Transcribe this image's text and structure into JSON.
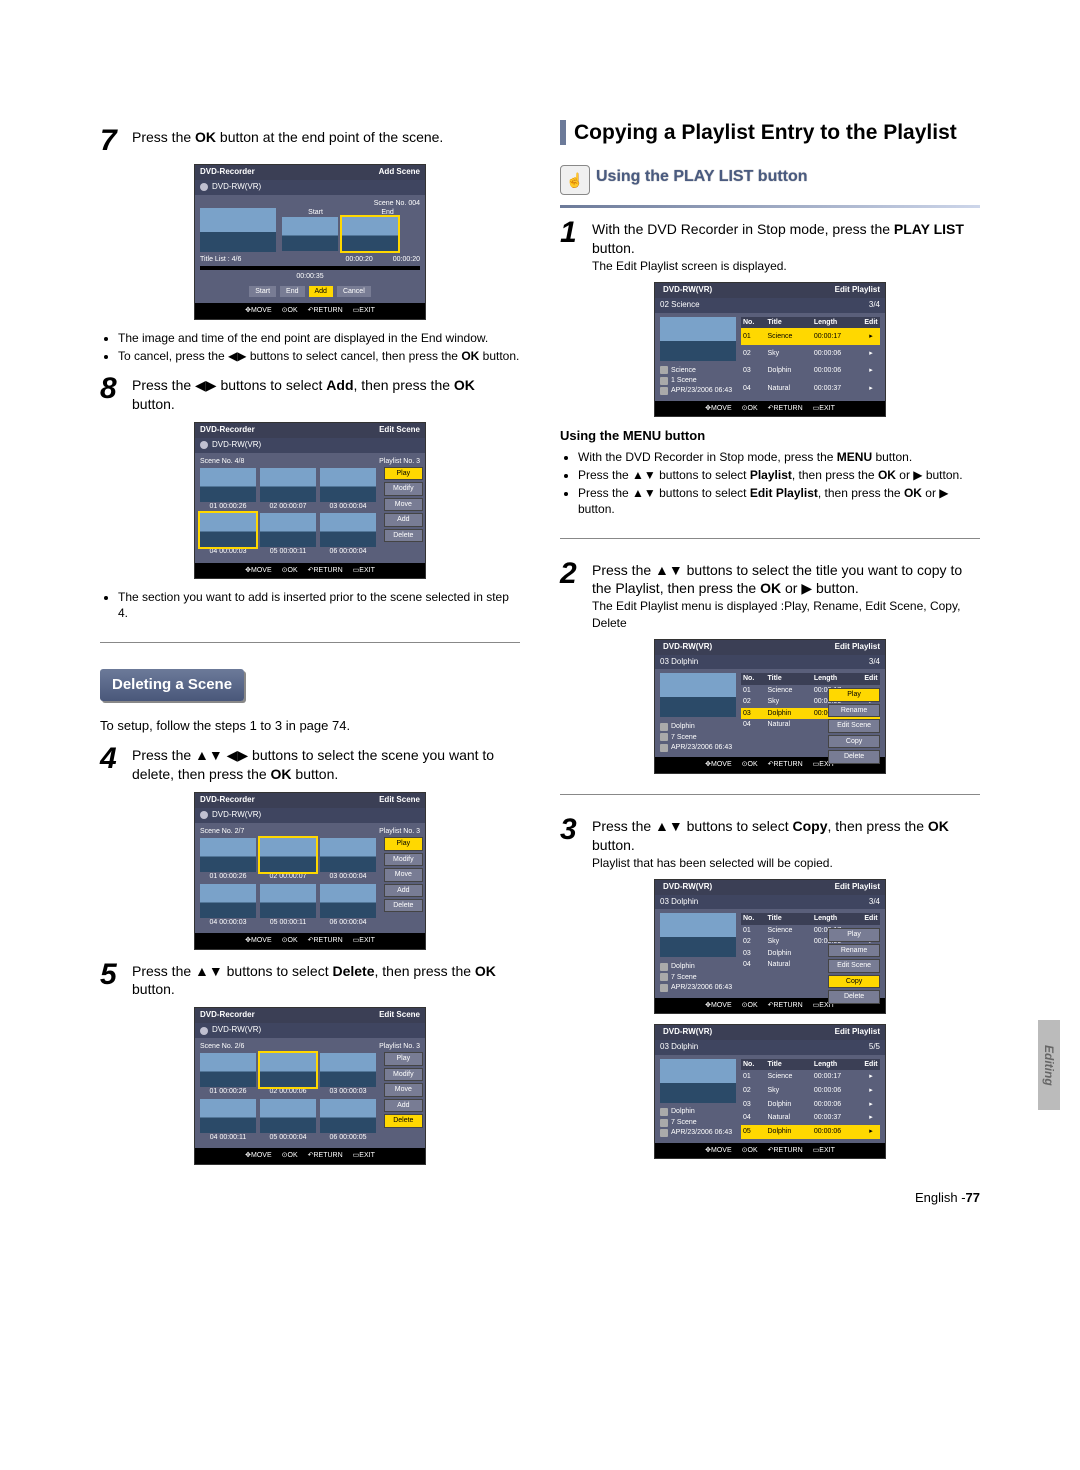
{
  "left": {
    "step7": {
      "num": "7",
      "text_a": "Press the ",
      "bold_a": "OK",
      "text_b": " button at the end point of the scene.",
      "bullets": [
        "The image and time of the end point are displayed in the End window.",
        "To cancel, press the ◀▶ buttons to select cancel, then press the OK button."
      ]
    },
    "screen7": {
      "title": "DVD-Recorder",
      "mode": "Add Scene",
      "disc": "DVD-RW(VR)",
      "scene_no": "Scene No. 004",
      "start_lbl": "Start",
      "end_lbl": "End",
      "title_list": "Title List : 4/6",
      "t1": "00:00:20",
      "t2": "00:00:20",
      "t3": "00:00:35",
      "btns": [
        "Start",
        "End",
        "Add",
        "Cancel"
      ],
      "bar": {
        "move": "MOVE",
        "ok": "OK",
        "return": "RETURN",
        "exit": "EXIT"
      }
    },
    "step8": {
      "num": "8",
      "text": "Press the ◀▶ buttons to select Add, then press the OK button.",
      "bullets": [
        "The section you want to add is inserted prior to the scene selected in step 4."
      ]
    },
    "screen8": {
      "title": "DVD-Recorder",
      "mode": "Edit Scene",
      "disc": "DVD-RW(VR)",
      "scene_no": "Scene No.    4/8",
      "playlist": "Playlist No. 3",
      "cells": [
        {
          "n": "01",
          "t": "00:00:26"
        },
        {
          "n": "02",
          "t": "00:00:07"
        },
        {
          "n": "03",
          "t": "00:00:04"
        },
        {
          "n": "04",
          "t": "00:00:03"
        },
        {
          "n": "05",
          "t": "00:00:11"
        },
        {
          "n": "06",
          "t": "00:00:04"
        }
      ],
      "menu": [
        "Play",
        "Modify",
        "Move",
        "Add",
        "Delete"
      ],
      "bar": {
        "move": "MOVE",
        "ok": "OK",
        "return": "RETURN",
        "exit": "EXIT"
      }
    },
    "delete_heading": "Deleting a Scene",
    "delete_intro": "To setup, follow the steps 1 to 3 in page 74.",
    "step4": {
      "num": "4",
      "text": "Press the ▲▼ ◀▶ buttons to select the scene you want to delete, then press the OK button."
    },
    "screen4": {
      "title": "DVD-Recorder",
      "mode": "Edit Scene",
      "disc": "DVD-RW(VR)",
      "scene_no": "Scene No.    2/7",
      "playlist": "Playlist No. 3",
      "cells": [
        {
          "n": "01",
          "t": "00:00:26"
        },
        {
          "n": "02",
          "t": "00:00:07"
        },
        {
          "n": "03",
          "t": "00:00:04"
        },
        {
          "n": "04",
          "t": "00:00:03"
        },
        {
          "n": "05",
          "t": "00:00:11"
        },
        {
          "n": "06",
          "t": "00:00:04"
        }
      ],
      "menu": [
        "Play",
        "Modify",
        "Move",
        "Add",
        "Delete"
      ],
      "bar": {
        "move": "MOVE",
        "ok": "OK",
        "return": "RETURN",
        "exit": "EXIT"
      }
    },
    "step5": {
      "num": "5",
      "text": "Press the ▲▼ buttons to select Delete, then press the OK button."
    },
    "screen5": {
      "title": "DVD-Recorder",
      "mode": "Edit Scene",
      "disc": "DVD-RW(VR)",
      "scene_no": "Scene No.    2/6",
      "playlist": "Playlist No. 3",
      "cells": [
        {
          "n": "01",
          "t": "00:00:26"
        },
        {
          "n": "02",
          "t": "00:00:06"
        },
        {
          "n": "03",
          "t": "00:00:03"
        },
        {
          "n": "04",
          "t": "00:00:11"
        },
        {
          "n": "05",
          "t": "00:00:04"
        },
        {
          "n": "06",
          "t": "00:00:05"
        }
      ],
      "menu": [
        "Play",
        "Modify",
        "Move",
        "Add",
        "Delete"
      ],
      "bar": {
        "move": "MOVE",
        "ok": "OK",
        "return": "RETURN",
        "exit": "EXIT"
      }
    }
  },
  "right": {
    "h1": "Copying a Playlist Entry to the Playlist",
    "h2": "Using the PLAY LIST button",
    "step1": {
      "num": "1",
      "l1": "With the DVD Recorder in Stop mode, press the PLAY LIST button.",
      "l2": "The Edit Playlist screen is displayed."
    },
    "screen1": {
      "disc": "DVD-RW(VR)",
      "mode": "Edit Playlist",
      "sub": "02 Science",
      "counter": "3/4",
      "headers": {
        "no": "No.",
        "title": "Title",
        "length": "Length",
        "edit": "Edit"
      },
      "rows": [
        {
          "no": "01",
          "title": "Science",
          "length": "00:00:17",
          "hl": true
        },
        {
          "no": "02",
          "title": "Sky",
          "length": "00:00:06"
        },
        {
          "no": "03",
          "title": "Dolphin",
          "length": "00:00:06"
        },
        {
          "no": "04",
          "title": "Natural",
          "length": "00:00:37"
        }
      ],
      "meta": {
        "t": "Science",
        "s": "1 Scene",
        "d": "APR/23/2006 06:43"
      },
      "bar": {
        "move": "MOVE",
        "ok": "OK",
        "return": "RETURN",
        "exit": "EXIT"
      }
    },
    "menu_h": "Using the MENU button",
    "menu_bullets": [
      "With the DVD Recorder in Stop mode, press the MENU button.",
      "Press the ▲▼ buttons to select Playlist, then press the OK or ▶ button.",
      "Press the ▲▼ buttons to select Edit Playlist, then press the OK or ▶ button."
    ],
    "step2": {
      "num": "2",
      "l1": "Press the ▲▼ buttons to select the title you want to copy to the Playlist, then press the OK or ▶ button.",
      "l2": "The Edit Playlist menu is displayed :Play, Rename, Edit Scene, Copy, Delete"
    },
    "screen2": {
      "disc": "DVD-RW(VR)",
      "mode": "Edit Playlist",
      "sub": "03 Dolphin",
      "counter": "3/4",
      "rows": [
        {
          "no": "01",
          "title": "Science",
          "length": "00:00:17"
        },
        {
          "no": "02",
          "title": "Sky",
          "length": "00:00:06"
        },
        {
          "no": "03",
          "title": "Dolphin",
          "length": "00:00:06",
          "hl": true
        },
        {
          "no": "04",
          "title": "Natural",
          "length": ""
        }
      ],
      "menu": [
        "Play",
        "Rename",
        "Edit Scene",
        "Copy",
        "Delete"
      ],
      "meta": {
        "t": "Dolphin",
        "s": "7 Scene",
        "d": "APR/23/2006 06:43"
      },
      "bar": {
        "move": "MOVE",
        "ok": "OK",
        "return": "RETURN",
        "exit": "EXIT"
      }
    },
    "step3": {
      "num": "3",
      "l1": "Press the ▲▼ buttons to select Copy, then press the OK button.",
      "l2": "Playlist that has been selected will be copied."
    },
    "screen3a": {
      "disc": "DVD-RW(VR)",
      "mode": "Edit Playlist",
      "sub": "03 Dolphin",
      "counter": "3/4",
      "rows": [
        {
          "no": "01",
          "title": "Science",
          "length": "00:00:17"
        },
        {
          "no": "02",
          "title": "Sky",
          "length": "00:00:06"
        },
        {
          "no": "03",
          "title": "Dolphin",
          "length": ""
        },
        {
          "no": "04",
          "title": "Natural",
          "length": ""
        }
      ],
      "menu": [
        "Play",
        "Rename",
        "Edit Scene",
        "Copy",
        "Delete"
      ],
      "menu_hl": "Copy",
      "meta": {
        "t": "Dolphin",
        "s": "7 Scene",
        "d": "APR/23/2006 06:43"
      },
      "bar": {
        "move": "MOVE",
        "ok": "OK",
        "return": "RETURN",
        "exit": "EXIT"
      }
    },
    "screen3b": {
      "disc": "DVD-RW(VR)",
      "mode": "Edit Playlist",
      "sub": "03 Dolphin",
      "counter": "5/5",
      "rows": [
        {
          "no": "01",
          "title": "Science",
          "length": "00:00:17"
        },
        {
          "no": "02",
          "title": "Sky",
          "length": "00:00:06"
        },
        {
          "no": "03",
          "title": "Dolphin",
          "length": "00:00:06"
        },
        {
          "no": "04",
          "title": "Natural",
          "length": "00:00:37"
        },
        {
          "no": "05",
          "title": "Dolphin",
          "length": "00:00:06",
          "hl": true
        }
      ],
      "meta": {
        "t": "Dolphin",
        "s": "7 Scene",
        "d": "APR/23/2006 06:43"
      },
      "bar": {
        "move": "MOVE",
        "ok": "OK",
        "return": "RETURN",
        "exit": "EXIT"
      }
    }
  },
  "side_tab": "Editing",
  "footer": {
    "lang": "English -",
    "page": "77"
  }
}
